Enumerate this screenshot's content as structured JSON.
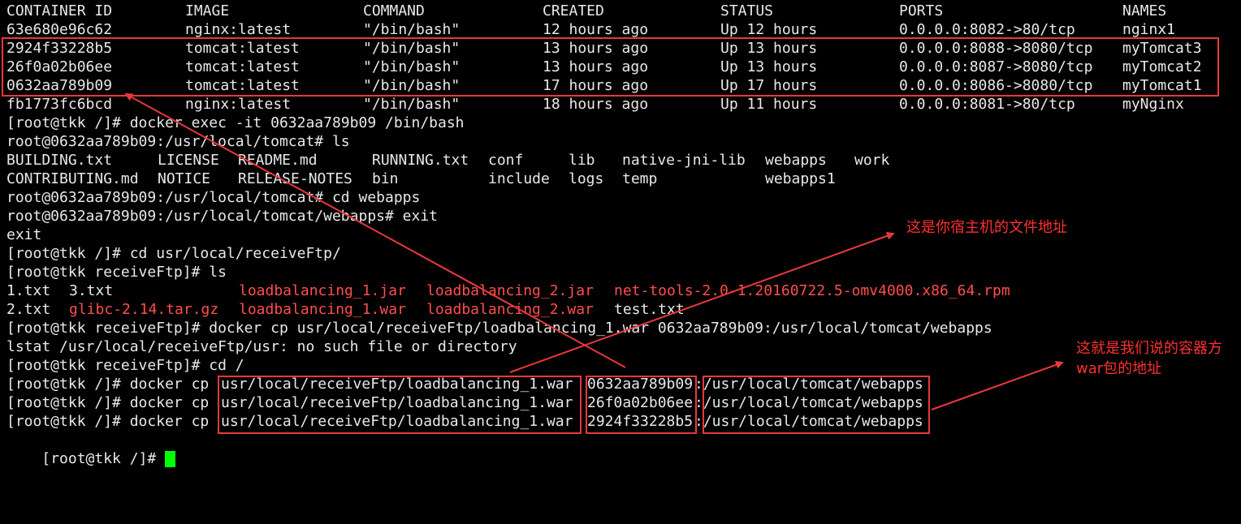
{
  "colors": {
    "background": "#000000",
    "text": "#e8e8e8",
    "highlight_text": "#ff4d4d",
    "annotation": "#e8383d",
    "cursor": "#00ff00"
  },
  "docker_ps": {
    "headers": [
      "CONTAINER ID",
      "IMAGE",
      "COMMAND",
      "CREATED",
      "STATUS",
      "PORTS",
      "NAMES"
    ],
    "rows": [
      [
        "63e680e96c62",
        "nginx:latest",
        "\"/bin/bash\"",
        "12 hours ago",
        "Up 12 hours",
        "0.0.0.0:8082->80/tcp",
        "nginx1"
      ],
      [
        "2924f33228b5",
        "tomcat:latest",
        "\"/bin/bash\"",
        "13 hours ago",
        "Up 13 hours",
        "0.0.0.0:8088->8080/tcp",
        "myTomcat3"
      ],
      [
        "26f0a02b06ee",
        "tomcat:latest",
        "\"/bin/bash\"",
        "13 hours ago",
        "Up 13 hours",
        "0.0.0.0:8087->8080/tcp",
        "myTomcat2"
      ],
      [
        "0632aa789b09",
        "tomcat:latest",
        "\"/bin/bash\"",
        "17 hours ago",
        "Up 17 hours",
        "0.0.0.0:8086->8080/tcp",
        "myTomcat1"
      ],
      [
        "fb1773fc6bcd",
        "nginx:latest",
        "\"/bin/bash\"",
        "18 hours ago",
        "Up 11 hours",
        "0.0.0.0:8081->80/tcp",
        "myNginx"
      ]
    ]
  },
  "session": {
    "l1": "[root@tkk /]# docker exec -it 0632aa789b09 /bin/bash",
    "l2": "root@0632aa789b09:/usr/local/tomcat# ls",
    "ls1": [
      "BUILDING.txt",
      "LICENSE",
      "README.md",
      "RUNNING.txt",
      "conf",
      "lib",
      "native-jni-lib",
      "webapps",
      "work"
    ],
    "ls2": [
      "CONTRIBUTING.md",
      "NOTICE",
      "RELEASE-NOTES",
      "bin",
      "include",
      "logs",
      "temp",
      "webapps1"
    ],
    "l3": "root@0632aa789b09:/usr/local/tomcat# cd webapps",
    "l4": "root@0632aa789b09:/usr/local/tomcat/webapps# exit",
    "l5": "exit",
    "l6": "[root@tkk /]# cd usr/local/receiveFtp/",
    "l7": "[root@tkk receiveFtp]# ls",
    "files1": [
      "1.txt",
      "3.txt",
      "loadbalancing_1.jar",
      "loadbalancing_2.jar",
      "net-tools-2.0-1.20160722.5-omv4000.x86_64.rpm"
    ],
    "files2": [
      "2.txt",
      "glibc-2.14.tar.gz",
      "loadbalancing_1.war",
      "loadbalancing_2.war",
      "test.txt"
    ],
    "l8": "[root@tkk receiveFtp]# docker cp usr/local/receiveFtp/loadbalancing_1.war 0632aa789b09:/usr/local/tomcat/webapps",
    "l9": "lstat /usr/local/receiveFtp/usr: no such file or directory",
    "l10": "[root@tkk receiveFtp]# cd /",
    "cp_prefix": "[root@tkk /]# docker cp ",
    "cp_src": "usr/local/receiveFtp/loadbalancing_1.war",
    "cp_ids": [
      "0632aa789b09",
      "26f0a02b06ee",
      "2924f33228b5"
    ],
    "cp_dest": ":/usr/local/tomcat/webapps",
    "prompt_last": "[root@tkk /]# "
  },
  "annotations": {
    "host_path_note": "这是你宿主机的文件地址",
    "container_note_line1": "这就是我们说的容器方",
    "container_note_line2": "war包的地址"
  }
}
